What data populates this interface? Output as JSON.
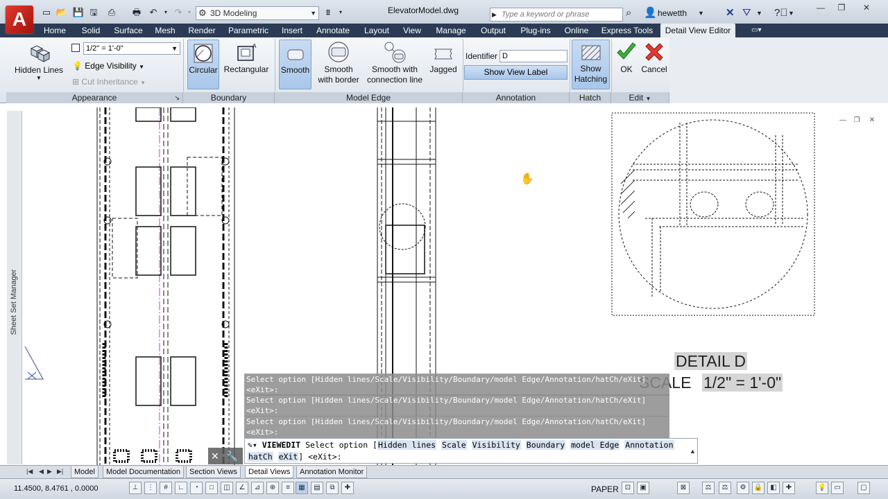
{
  "app": {
    "logo_letter": "A",
    "document_title": "ElevatorModel.dwg",
    "workspace": "3D Modeling",
    "search_placeholder": "Type a keyword or phrase",
    "user": "hewetth"
  },
  "ribbon_tabs": [
    "Home",
    "Solid",
    "Surface",
    "Mesh",
    "Render",
    "Parametric",
    "Insert",
    "Annotate",
    "Layout",
    "View",
    "Manage",
    "Output",
    "Plug-ins",
    "Online",
    "Express Tools",
    "Detail View Editor"
  ],
  "ribbon": {
    "appearance": {
      "title": "Appearance",
      "hidden_lines": "Hidden Lines",
      "scale": "1/2\" = 1'-0\"",
      "edge_visibility": "Edge Visibility",
      "cut_inheritance": "Cut Inheritance"
    },
    "boundary": {
      "title": "Boundary",
      "circular": "Circular",
      "rectangular": "Rectangular"
    },
    "model_edge": {
      "title": "Model Edge",
      "smooth": "Smooth",
      "smooth_border_1": "Smooth",
      "smooth_border_2": "with border",
      "smooth_conn_1": "Smooth with",
      "smooth_conn_2": "connection line",
      "jagged": "Jagged"
    },
    "annotation": {
      "title": "Annotation",
      "identifier_label": "Identifier",
      "identifier_value": "D",
      "show_view_label": "Show View Label"
    },
    "hatch": {
      "title": "Hatch",
      "show_hatching_1": "Show",
      "show_hatching_2": "Hatching"
    },
    "edit": {
      "title": "Edit",
      "ok": "OK",
      "cancel": "Cancel"
    }
  },
  "side_palette": "Sheet Set Manager",
  "detail_label": {
    "title": "DETAIL D",
    "scale_label": "SCALE",
    "scale_value": "1/2\" = 1'-0\""
  },
  "command_history": [
    [
      "Select option [Hidden lines/Scale/Visibility/Boundary/model Edge/Annotation/hatCh/eXit]",
      "<eXit>:"
    ],
    [
      "Select option [Hidden lines/Scale/Visibility/Boundary/model Edge/Annotation/hatCh/eXit]",
      "<eXit>:"
    ],
    [
      "Select option [Hidden lines/Scale/Visibility/Boundary/model Edge/Annotation/hatCh/eXit]",
      "<eXit>:"
    ]
  ],
  "command_line": {
    "command": "VIEWEDIT",
    "prompt": "Select option [",
    "options": [
      "Hidden lines",
      "Scale",
      "Visibility",
      "Boundary",
      "model Edge",
      "Annotation"
    ],
    "options_line2": [
      "hatCh",
      "eXit"
    ],
    "suffix": "] <eXit>:"
  },
  "layout_tabs": [
    "Model",
    "Model Documentation",
    "Section Views",
    "Detail Views",
    "Annotation Monitor"
  ],
  "active_layout_tab": "Detail Views",
  "status": {
    "coordinates": "11.4500, 8.4761 , 0.0000",
    "space": "PAPER"
  }
}
